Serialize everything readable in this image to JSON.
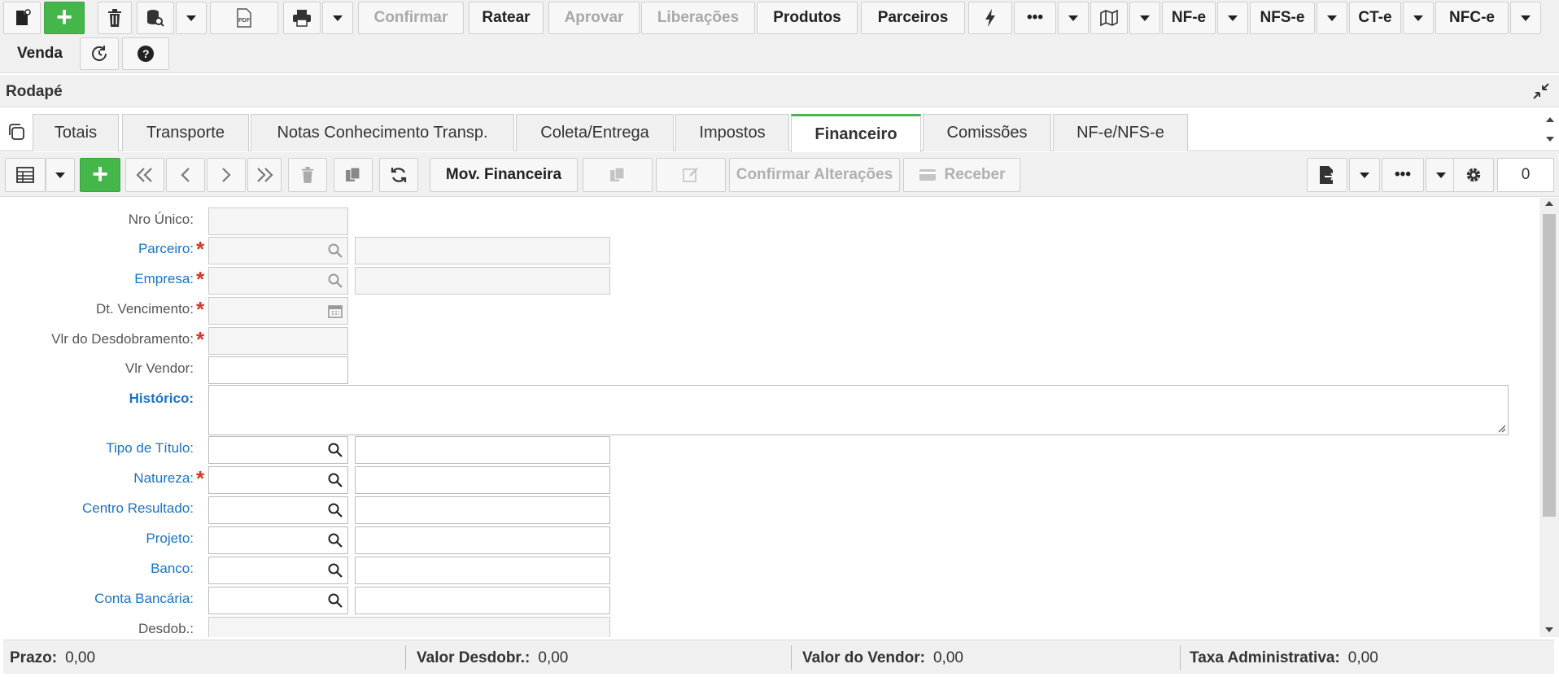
{
  "toolbar": {
    "confirmar": "Confirmar",
    "ratear": "Ratear",
    "aprovar": "Aprovar",
    "liberacoes": "Liberações",
    "produtos": "Produtos",
    "parceiros": "Parceiros",
    "more": "•••",
    "nfe": "NF-e",
    "nfse": "NFS-e",
    "cte": "CT-e",
    "nfce": "NFC-e",
    "venda": "Venda"
  },
  "section": {
    "title": "Rodapé"
  },
  "tabs": [
    {
      "label": "Totais"
    },
    {
      "label": "Transporte"
    },
    {
      "label": "Notas Conhecimento Transp."
    },
    {
      "label": "Coleta/Entrega"
    },
    {
      "label": "Impostos"
    },
    {
      "label": "Financeiro"
    },
    {
      "label": "Comissões"
    },
    {
      "label": "NF-e/NFS-e"
    }
  ],
  "grid_toolbar": {
    "mov_financeira": "Mov. Financeira",
    "confirmar_alteracoes": "Confirmar Alterações",
    "receber": "Receber",
    "more": "•••",
    "counter": "0"
  },
  "form": {
    "nro_unico": "Nro Único:",
    "parceiro": "Parceiro:",
    "empresa": "Empresa:",
    "dt_vencimento": "Dt. Vencimento:",
    "vlr_desdobramento": "Vlr do Desdobramento:",
    "vlr_vendor": "Vlr Vendor:",
    "historico": "Histórico:",
    "tipo_titulo": "Tipo de Título:",
    "natureza": "Natureza:",
    "centro_resultado": "Centro Resultado:",
    "projeto": "Projeto:",
    "banco": "Banco:",
    "conta_bancaria": "Conta Bancária:",
    "desdob": "Desdob.:",
    "required_mark": "*"
  },
  "footer": {
    "prazo_label": "Prazo:",
    "prazo_value": "0,00",
    "valor_desdobr_label": "Valor Desdobr.:",
    "valor_desdobr_value": "0,00",
    "valor_vendor_label": "Valor do Vendor:",
    "valor_vendor_value": "0,00",
    "taxa_label": "Taxa Administrativa:",
    "taxa_value": "0,00"
  },
  "colors": {
    "accent_green": "#45b649",
    "link_blue": "#1a73c8",
    "required_red": "#d9342b"
  },
  "icons": [
    "new-document-icon",
    "plus-icon",
    "trash-icon",
    "database-search-icon",
    "pdf-icon",
    "printer-icon",
    "lightning-icon",
    "map-icon",
    "refresh-clock-icon",
    "help-icon",
    "collapse-icon",
    "copy-icon",
    "grid-icon",
    "first-icon",
    "prev-icon",
    "next-icon",
    "last-icon",
    "copy-records-icon",
    "refresh-icon",
    "edit-icon",
    "card-icon",
    "export-icon",
    "gear-icon",
    "search-icon",
    "calendar-icon"
  ]
}
